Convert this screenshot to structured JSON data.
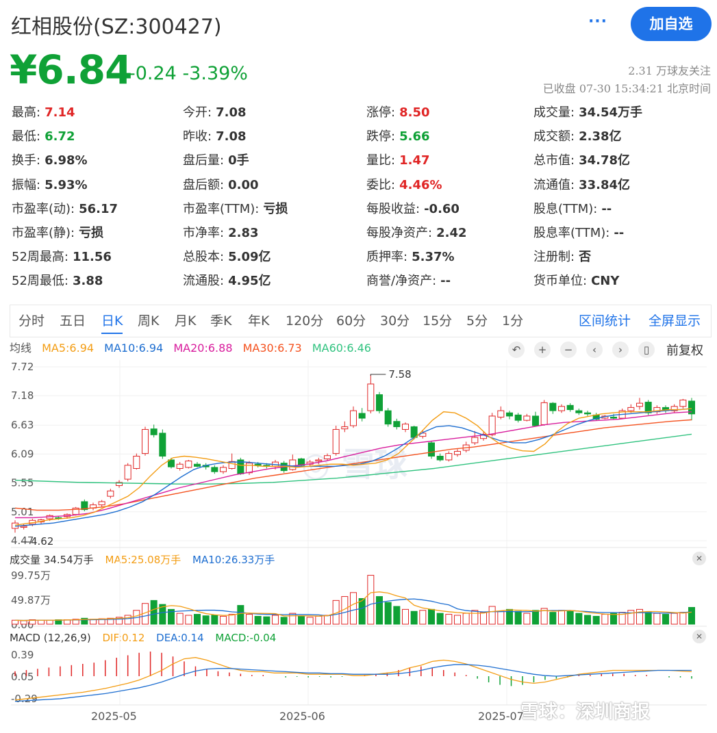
{
  "header": {
    "title": "红相股份(SZ:300427)",
    "more_label": "···",
    "add_button": "加自选",
    "price": "¥6.84",
    "change": "-0.24  -3.39%",
    "followers": "2.31 万球友关注",
    "status": "已收盘 07-30 15:34:21 北京时间"
  },
  "colors": {
    "up": "#e02525",
    "down": "#0fa136",
    "accent": "#1f73e8",
    "ma5": "#f39c12",
    "ma10": "#1c6dd0",
    "ma20": "#d81b9c",
    "ma30": "#f4511e",
    "ma60": "#2ec27e"
  },
  "quote": {
    "rows": [
      [
        {
          "label": "最高:",
          "value": "7.14",
          "tone": "up"
        },
        {
          "label": "今开:",
          "value": "7.08",
          "tone": ""
        },
        {
          "label": "涨停:",
          "value": "8.50",
          "tone": "up"
        },
        {
          "label": "成交量:",
          "value": "34.54万手",
          "tone": ""
        }
      ],
      [
        {
          "label": "最低:",
          "value": "6.72",
          "tone": "down"
        },
        {
          "label": "昨收:",
          "value": "7.08",
          "tone": ""
        },
        {
          "label": "跌停:",
          "value": "5.66",
          "tone": "down"
        },
        {
          "label": "成交额:",
          "value": "2.38亿",
          "tone": ""
        }
      ],
      [
        {
          "label": "换手:",
          "value": "6.98%",
          "tone": ""
        },
        {
          "label": "盘后量:",
          "value": "0手",
          "tone": ""
        },
        {
          "label": "量比:",
          "value": "1.47",
          "tone": "up"
        },
        {
          "label": "总市值:",
          "value": "34.78亿",
          "tone": ""
        }
      ],
      [
        {
          "label": "振幅:",
          "value": "5.93%",
          "tone": ""
        },
        {
          "label": "盘后额:",
          "value": "0.00",
          "tone": ""
        },
        {
          "label": "委比:",
          "value": "4.46%",
          "tone": "up"
        },
        {
          "label": "流通值:",
          "value": "33.84亿",
          "tone": ""
        }
      ],
      [
        {
          "label": "市盈率(动):",
          "value": "56.17",
          "tone": ""
        },
        {
          "label": "市盈率(TTM):",
          "value": "亏损",
          "tone": ""
        },
        {
          "label": "每股收益:",
          "value": "-0.60",
          "tone": ""
        },
        {
          "label": "股息(TTM):",
          "value": "--",
          "tone": ""
        }
      ],
      [
        {
          "label": "市盈率(静):",
          "value": "亏损",
          "tone": ""
        },
        {
          "label": "市净率:",
          "value": "2.83",
          "tone": ""
        },
        {
          "label": "每股净资产:",
          "value": "2.42",
          "tone": ""
        },
        {
          "label": "股息率(TTM):",
          "value": "--",
          "tone": ""
        }
      ],
      [
        {
          "label": "52周最高:",
          "value": "11.56",
          "tone": ""
        },
        {
          "label": "总股本:",
          "value": "5.09亿",
          "tone": ""
        },
        {
          "label": "质押率:",
          "value": "5.37%",
          "tone": ""
        },
        {
          "label": "注册制:",
          "value": "否",
          "tone": ""
        }
      ],
      [
        {
          "label": "52周最低:",
          "value": "3.88",
          "tone": ""
        },
        {
          "label": "流通股:",
          "value": "4.95亿",
          "tone": ""
        },
        {
          "label": "商誉/净资产:",
          "value": "--",
          "tone": ""
        },
        {
          "label": "货币单位:",
          "value": "CNY",
          "tone": ""
        }
      ]
    ]
  },
  "tabs": {
    "items": [
      "分时",
      "五日",
      "日K",
      "周K",
      "月K",
      "季K",
      "年K",
      "120分",
      "60分",
      "30分",
      "15分",
      "5分",
      "1分"
    ],
    "active": "日K",
    "right": [
      "区间统计",
      "全屏显示"
    ]
  },
  "ma": {
    "label": "均线",
    "ma5": "MA5:6.94",
    "ma10": "MA10:6.94",
    "ma20": "MA20:6.88",
    "ma30": "MA30:6.73",
    "ma60": "MA60:6.46"
  },
  "toolbar": {
    "icons": [
      "undo-icon",
      "zoom-in-icon",
      "zoom-out-icon",
      "scroll-left-icon",
      "scroll-right-icon",
      "candle-icon"
    ],
    "fq_label": "前复权"
  },
  "volume_panel": {
    "label": "成交量 34.54万手",
    "ma5": "MA5:25.08万手",
    "ma10": "MA10:26.33万手"
  },
  "macd_panel": {
    "label": "MACD (12,26,9)",
    "dif": "DIF:0.12",
    "dea": "DEA:0.14",
    "macd": "MACD:-0.04"
  },
  "watermark": "雪球：深圳商报",
  "chart_data": {
    "type": "candlestick",
    "ylim": [
      4.47,
      7.72
    ],
    "y_ticks": [
      "7.72",
      "7.18",
      "6.63",
      "6.09",
      "5.55",
      "5.01",
      "4.47"
    ],
    "x_ticks": [
      "2025-05",
      "2025-06",
      "2025-07"
    ],
    "annotations": {
      "high": "7.58",
      "low": "4.62"
    },
    "candles": [
      [
        4.7,
        4.8,
        4.62,
        4.85
      ],
      [
        4.72,
        4.74,
        4.68,
        4.78
      ],
      [
        4.78,
        4.85,
        4.74,
        4.88
      ],
      [
        4.82,
        4.86,
        4.78,
        4.88
      ],
      [
        4.88,
        4.94,
        4.84,
        4.96
      ],
      [
        4.9,
        4.89,
        4.86,
        4.93
      ],
      [
        4.92,
        4.96,
        4.88,
        4.98
      ],
      [
        4.96,
        5.08,
        4.94,
        5.1
      ],
      [
        5.2,
        5.05,
        5.02,
        5.24
      ],
      [
        5.08,
        5.14,
        5.04,
        5.18
      ],
      [
        5.14,
        5.2,
        5.1,
        5.23
      ],
      [
        5.3,
        5.4,
        5.26,
        5.44
      ],
      [
        5.5,
        5.56,
        5.46,
        5.6
      ],
      [
        5.62,
        5.88,
        5.58,
        5.92
      ],
      [
        5.82,
        6.05,
        5.8,
        6.1
      ],
      [
        6.1,
        6.55,
        6.06,
        6.6
      ],
      [
        6.56,
        6.45,
        6.4,
        6.64
      ],
      [
        6.48,
        6.05,
        6.0,
        6.55
      ],
      [
        5.98,
        5.85,
        5.82,
        6.02
      ],
      [
        5.82,
        5.9,
        5.78,
        5.94
      ],
      [
        5.84,
        5.96,
        5.82,
        5.98
      ],
      [
        5.9,
        5.86,
        5.84,
        5.94
      ],
      [
        5.88,
        5.85,
        5.8,
        5.92
      ],
      [
        5.84,
        5.76,
        5.72,
        5.88
      ],
      [
        5.76,
        5.84,
        5.72,
        5.88
      ],
      [
        5.82,
        5.95,
        5.8,
        6.1
      ],
      [
        5.98,
        5.72,
        5.7,
        6.02
      ],
      [
        5.74,
        5.92,
        5.7,
        5.96
      ],
      [
        5.9,
        5.88,
        5.84,
        5.94
      ],
      [
        5.88,
        5.86,
        5.82,
        5.92
      ],
      [
        5.86,
        5.94,
        5.8,
        5.98
      ],
      [
        5.92,
        5.78,
        5.74,
        5.96
      ],
      [
        5.8,
        5.98,
        5.78,
        6.08
      ],
      [
        6.0,
        5.88,
        5.84,
        6.02
      ],
      [
        5.9,
        5.94,
        5.86,
        5.98
      ],
      [
        5.96,
        5.98,
        5.9,
        6.02
      ],
      [
        6.0,
        6.06,
        5.96,
        6.1
      ],
      [
        6.1,
        6.55,
        6.06,
        6.62
      ],
      [
        6.56,
        6.6,
        6.5,
        6.7
      ],
      [
        6.62,
        6.9,
        6.58,
        6.98
      ],
      [
        6.85,
        6.76,
        6.7,
        6.95
      ],
      [
        6.9,
        7.4,
        6.85,
        7.58
      ],
      [
        7.2,
        6.9,
        6.85,
        7.25
      ],
      [
        6.9,
        6.65,
        6.6,
        6.95
      ],
      [
        6.7,
        6.6,
        6.55,
        6.75
      ],
      [
        6.55,
        6.65,
        6.5,
        6.68
      ],
      [
        6.6,
        6.4,
        6.36,
        6.62
      ],
      [
        6.42,
        6.48,
        6.38,
        6.54
      ],
      [
        6.3,
        6.05,
        6.0,
        6.34
      ],
      [
        6.05,
        5.98,
        5.95,
        6.1
      ],
      [
        5.98,
        6.1,
        5.95,
        6.14
      ],
      [
        6.08,
        6.14,
        6.04,
        6.18
      ],
      [
        6.16,
        6.26,
        6.12,
        6.32
      ],
      [
        6.3,
        6.4,
        6.26,
        6.52
      ],
      [
        6.38,
        6.46,
        6.34,
        6.5
      ],
      [
        6.45,
        6.8,
        6.42,
        6.86
      ],
      [
        6.78,
        6.9,
        6.74,
        6.98
      ],
      [
        6.86,
        6.8,
        6.74,
        6.9
      ],
      [
        6.82,
        6.72,
        6.68,
        6.86
      ],
      [
        6.72,
        6.8,
        6.7,
        6.84
      ],
      [
        6.8,
        6.62,
        6.6,
        6.88
      ],
      [
        6.64,
        7.05,
        6.62,
        7.1
      ],
      [
        7.04,
        6.9,
        6.84,
        7.06
      ],
      [
        6.9,
        6.98,
        6.86,
        7.02
      ],
      [
        7.0,
        6.92,
        6.88,
        7.04
      ],
      [
        6.9,
        6.86,
        6.82,
        6.94
      ],
      [
        6.86,
        6.84,
        6.8,
        6.9
      ],
      [
        6.82,
        6.74,
        6.72,
        6.86
      ],
      [
        6.76,
        6.8,
        6.74,
        6.82
      ],
      [
        6.78,
        6.76,
        6.74,
        6.84
      ],
      [
        6.76,
        6.9,
        6.74,
        6.94
      ],
      [
        6.9,
        6.96,
        6.86,
        7.02
      ],
      [
        6.98,
        7.04,
        6.92,
        7.14
      ],
      [
        7.06,
        6.86,
        6.82,
        7.1
      ],
      [
        6.88,
        6.96,
        6.84,
        7.0
      ],
      [
        6.96,
        6.9,
        6.86,
        7.0
      ],
      [
        6.9,
        6.98,
        6.86,
        7.02
      ],
      [
        6.98,
        7.1,
        6.94,
        7.12
      ],
      [
        7.08,
        6.84,
        6.72,
        7.14
      ]
    ],
    "ma5": [
      4.76,
      4.79,
      4.82,
      4.86,
      4.88,
      4.9,
      4.94,
      5.0,
      5.1,
      5.2,
      5.3,
      5.46,
      5.68,
      5.88,
      6.02,
      6.05,
      6.03,
      6.0,
      5.96,
      5.92,
      5.88,
      5.88,
      5.86,
      5.86,
      5.86,
      5.84,
      5.86,
      5.88,
      5.9,
      5.9,
      5.88,
      5.9,
      5.92,
      5.98,
      6.1,
      6.3,
      6.5,
      6.72,
      6.88,
      6.86,
      6.76,
      6.62,
      6.42,
      6.28,
      6.2,
      6.15,
      6.14,
      6.28,
      6.5,
      6.66,
      6.76,
      6.8,
      6.84,
      6.86,
      6.88,
      6.88,
      6.88,
      6.9,
      6.92,
      6.92,
      6.94
    ],
    "ma10": [
      4.74,
      4.76,
      4.78,
      4.8,
      4.84,
      4.88,
      4.92,
      4.96,
      5.02,
      5.1,
      5.2,
      5.34,
      5.5,
      5.66,
      5.8,
      5.88,
      5.92,
      5.94,
      5.94,
      5.92,
      5.9,
      5.88,
      5.86,
      5.86,
      5.86,
      5.86,
      5.88,
      5.9,
      5.96,
      6.06,
      6.2,
      6.36,
      6.5,
      6.6,
      6.62,
      6.58,
      6.5,
      6.42,
      6.34,
      6.3,
      6.3,
      6.36,
      6.44,
      6.54,
      6.64,
      6.72,
      6.78,
      6.82,
      6.84,
      6.86,
      6.88,
      6.9,
      6.92,
      6.94
    ],
    "ma20": [
      4.9,
      4.9,
      4.92,
      4.94,
      4.98,
      5.06,
      5.16,
      5.26,
      5.36,
      5.46,
      5.54,
      5.62,
      5.7,
      5.76,
      5.82,
      5.86,
      5.9,
      5.96,
      6.04,
      6.12,
      6.2,
      6.26,
      6.3,
      6.34,
      6.38,
      6.42,
      6.46,
      6.52,
      6.58,
      6.64,
      6.68,
      6.7,
      6.72,
      6.74,
      6.78,
      6.82,
      6.86,
      6.88
    ],
    "ma30": [
      5.08,
      5.04,
      5.04,
      5.06,
      5.1,
      5.16,
      5.24,
      5.32,
      5.4,
      5.48,
      5.56,
      5.64,
      5.7,
      5.76,
      5.82,
      5.88,
      5.94,
      6.0,
      6.06,
      6.12,
      6.18,
      6.22,
      6.28,
      6.34,
      6.4,
      6.46,
      6.52,
      6.58,
      6.62,
      6.66,
      6.7,
      6.73
    ],
    "ma60": [
      5.6,
      5.58,
      5.56,
      5.55,
      5.54,
      5.53,
      5.53,
      5.54,
      5.56,
      5.6,
      5.64,
      5.7,
      5.76,
      5.82,
      5.9,
      5.98,
      6.06,
      6.14,
      6.22,
      6.3,
      6.38,
      6.46
    ],
    "volume_ylim": [
      0,
      99.75
    ],
    "volume_ticks": [
      "99.75万",
      "49.87万",
      "0.00"
    ],
    "volume": [
      8,
      7,
      9,
      8,
      8,
      9,
      9,
      10,
      12,
      10,
      11,
      12,
      14,
      18,
      28,
      42,
      48,
      40,
      30,
      22,
      18,
      20,
      17,
      18,
      16,
      20,
      38,
      20,
      16,
      15,
      18,
      14,
      22,
      16,
      14,
      16,
      18,
      48,
      56,
      64,
      52,
      99,
      56,
      44,
      36,
      30,
      26,
      28,
      30,
      22,
      20,
      18,
      22,
      28,
      24,
      36,
      26,
      30,
      26,
      22,
      28,
      32,
      24,
      28,
      26,
      22,
      18,
      16,
      20,
      22,
      24,
      28,
      30,
      24,
      22,
      20,
      22,
      24,
      34
    ],
    "macd_ylim": [
      -0.29,
      0.39
    ],
    "macd_ticks": [
      "0.39",
      "0.05",
      "-0.29"
    ],
    "dif": [
      -0.32,
      -0.3,
      -0.28,
      -0.26,
      -0.24,
      -0.22,
      -0.2,
      -0.17,
      -0.14,
      -0.1,
      -0.06,
      -0.01,
      0.06,
      0.14,
      0.24,
      0.32,
      0.34,
      0.3,
      0.24,
      0.18,
      0.14,
      0.12,
      0.12,
      0.1,
      0.1,
      0.1,
      0.08,
      0.08,
      0.08,
      0.08,
      0.06,
      0.06,
      0.08,
      0.1,
      0.12,
      0.18,
      0.22,
      0.28,
      0.3,
      0.28,
      0.24,
      0.18,
      0.12,
      0.06,
      0.0,
      -0.04,
      -0.06,
      -0.04,
      0.0,
      0.04,
      0.08,
      0.1,
      0.12,
      0.14,
      0.14,
      0.14,
      0.14,
      0.14,
      0.14,
      0.13,
      0.12
    ],
    "dea": [
      -0.34,
      -0.33,
      -0.32,
      -0.31,
      -0.3,
      -0.28,
      -0.26,
      -0.24,
      -0.22,
      -0.19,
      -0.16,
      -0.13,
      -0.09,
      -0.04,
      0.02,
      0.08,
      0.13,
      0.16,
      0.17,
      0.17,
      0.16,
      0.15,
      0.14,
      0.13,
      0.12,
      0.11,
      0.1,
      0.1,
      0.09,
      0.09,
      0.08,
      0.08,
      0.08,
      0.08,
      0.09,
      0.11,
      0.14,
      0.18,
      0.21,
      0.23,
      0.23,
      0.22,
      0.2,
      0.17,
      0.14,
      0.11,
      0.08,
      0.06,
      0.05,
      0.06,
      0.07,
      0.08,
      0.09,
      0.1,
      0.11,
      0.12,
      0.13,
      0.14,
      0.14,
      0.14,
      0.14
    ],
    "macd": [
      0.08,
      0.1,
      0.12,
      0.14,
      0.16,
      0.18,
      0.2,
      0.22,
      0.26,
      0.3,
      0.34,
      0.38,
      0.4,
      0.38,
      0.32,
      0.24,
      0.16,
      0.12,
      0.08,
      0.06,
      0.04,
      0.02,
      0.02,
      0.0,
      -0.02,
      -0.01,
      -0.02,
      -0.01,
      -0.02,
      -0.01,
      0.0,
      0.02,
      0.04,
      0.06,
      0.1,
      0.14,
      0.16,
      0.14,
      0.1,
      0.06,
      0.02,
      -0.04,
      -0.1,
      -0.14,
      -0.16,
      -0.14,
      -0.1,
      -0.06,
      -0.04,
      -0.02,
      0.02,
      0.02,
      0.04,
      0.04,
      0.04,
      0.02,
      0.02,
      0.0,
      -0.02,
      -0.02,
      -0.04
    ]
  }
}
